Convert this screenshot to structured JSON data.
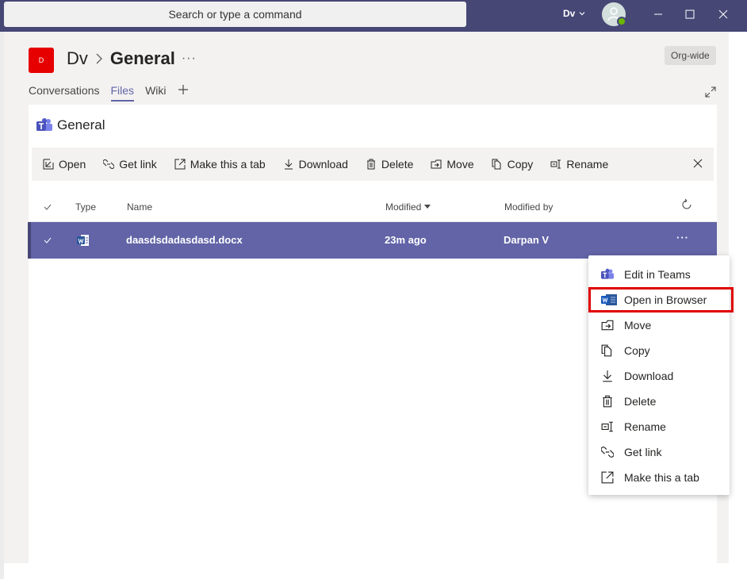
{
  "titlebar": {
    "search_placeholder": "Search or type a command",
    "user_label": "Dv",
    "status_color": "#6bb700",
    "bar_color": "#464775"
  },
  "header": {
    "team_avatar_text": "D",
    "team_name": "Dv",
    "channel_name": "General",
    "more_label": "···",
    "org_wide_label": "Org-wide"
  },
  "tabs": [
    {
      "label": "Conversations",
      "active": false
    },
    {
      "label": "Files",
      "active": true
    },
    {
      "label": "Wiki",
      "active": false
    }
  ],
  "panel": {
    "title": "General"
  },
  "commands": [
    {
      "label": "Open",
      "icon": "open-icon"
    },
    {
      "label": "Get link",
      "icon": "link-icon"
    },
    {
      "label": "Make this a tab",
      "icon": "external-link-icon"
    },
    {
      "label": "Download",
      "icon": "download-icon"
    },
    {
      "label": "Delete",
      "icon": "trash-icon"
    },
    {
      "label": "Move",
      "icon": "move-icon"
    },
    {
      "label": "Copy",
      "icon": "copy-icon"
    },
    {
      "label": "Rename",
      "icon": "rename-icon"
    }
  ],
  "table": {
    "headers": {
      "type": "Type",
      "name": "Name",
      "modified": "Modified",
      "modified_by": "Modified by"
    },
    "rows": [
      {
        "name": "daasdsdadasdasd.docx",
        "modified": "23m ago",
        "modified_by": "Darpan V",
        "more": "···",
        "selected": true
      }
    ]
  },
  "context_menu": {
    "items": [
      {
        "label": "Edit in Teams",
        "icon": "teams-icon"
      },
      {
        "label": "Open in Browser",
        "icon": "word-icon",
        "highlighted": true
      },
      {
        "label": "Move",
        "icon": "move-icon"
      },
      {
        "label": "Copy",
        "icon": "copy-icon"
      },
      {
        "label": "Download",
        "icon": "download-icon"
      },
      {
        "label": "Delete",
        "icon": "trash-icon"
      },
      {
        "label": "Rename",
        "icon": "rename-icon"
      },
      {
        "label": "Get link",
        "icon": "link-icon"
      },
      {
        "label": "Make this a tab",
        "icon": "external-link-icon"
      }
    ]
  },
  "colors": {
    "accent": "#6264a7",
    "highlight_border": "#e00000",
    "team_avatar": "#e60000"
  }
}
